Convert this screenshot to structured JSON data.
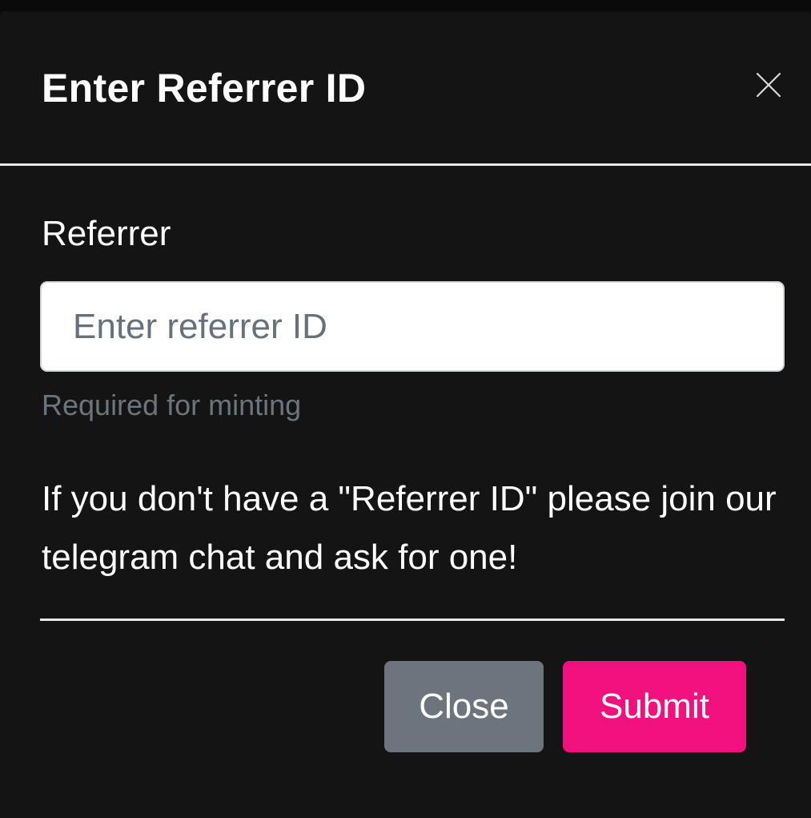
{
  "modal": {
    "title": "Enter Referrer ID",
    "close_icon": "close-icon"
  },
  "form": {
    "label": "Referrer",
    "input_value": "",
    "input_placeholder": "Enter referrer ID",
    "helper_text": "Required for minting"
  },
  "info": {
    "message": "If you don't have a \"Referrer ID\" please join our telegram chat and ask for one!"
  },
  "footer": {
    "close_label": "Close",
    "submit_label": "Submit"
  },
  "colors": {
    "modal_background": "#141414",
    "submit_accent": "#f0117f",
    "close_button": "#6c757d",
    "helper_text": "#6c757d"
  }
}
